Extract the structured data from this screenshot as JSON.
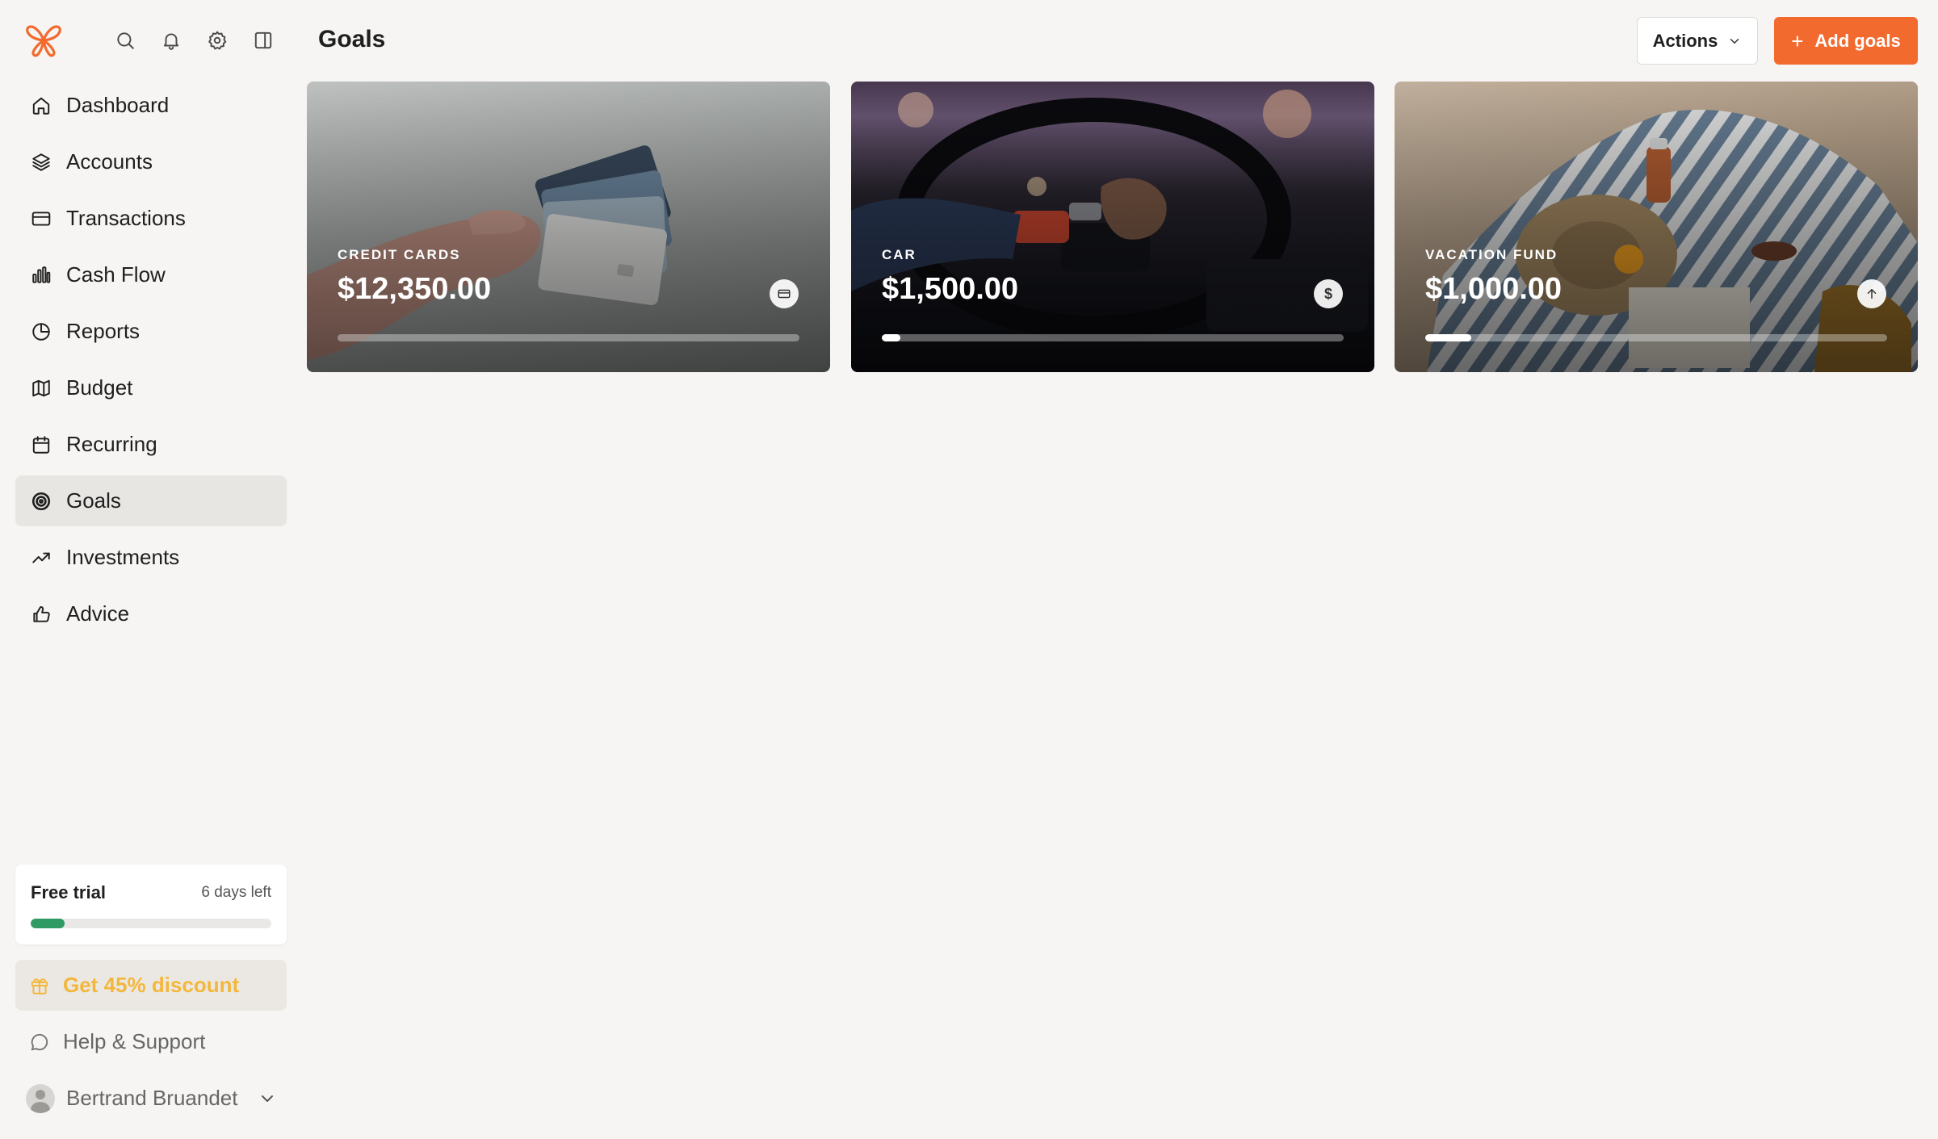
{
  "header": {
    "title": "Goals",
    "actions_label": "Actions",
    "add_label": "Add goals"
  },
  "colors": {
    "accent": "#f26a2e",
    "trial_progress": "#2f9a63",
    "discount": "#f3b73b",
    "active_nav_bg": "#e8e6e3",
    "page_bg": "#f6f5f3"
  },
  "top_icons": [
    "search-icon",
    "bell-icon",
    "gear-icon",
    "sidebar-toggle-icon"
  ],
  "sidebar": {
    "items": [
      {
        "label": "Dashboard",
        "icon": "home-icon"
      },
      {
        "label": "Accounts",
        "icon": "layers-icon"
      },
      {
        "label": "Transactions",
        "icon": "credit-card-icon"
      },
      {
        "label": "Cash Flow",
        "icon": "bar-chart-icon"
      },
      {
        "label": "Reports",
        "icon": "pie-chart-icon"
      },
      {
        "label": "Budget",
        "icon": "map-icon"
      },
      {
        "label": "Recurring",
        "icon": "calendar-icon"
      },
      {
        "label": "Goals",
        "icon": "target-icon",
        "active": true
      },
      {
        "label": "Investments",
        "icon": "trending-up-icon"
      },
      {
        "label": "Advice",
        "icon": "thumbs-up-icon"
      }
    ],
    "trial": {
      "title": "Free trial",
      "days_left": "6 days left",
      "progress_fraction": 0.14
    },
    "discount_label": "Get 45% discount",
    "help_label": "Help & Support",
    "user_name": "Bertrand Bruandet"
  },
  "goals": [
    {
      "category": "CREDIT CARDS",
      "amount": "$12,350.00",
      "icon": "credit-card-icon",
      "progress_fraction": 0.0
    },
    {
      "category": "CAR",
      "amount": "$1,500.00",
      "icon": "dollar-icon",
      "progress_fraction": 0.04
    },
    {
      "category": "VACATION FUND",
      "amount": "$1,000.00",
      "icon": "arrow-up-icon",
      "progress_fraction": 0.1
    }
  ]
}
